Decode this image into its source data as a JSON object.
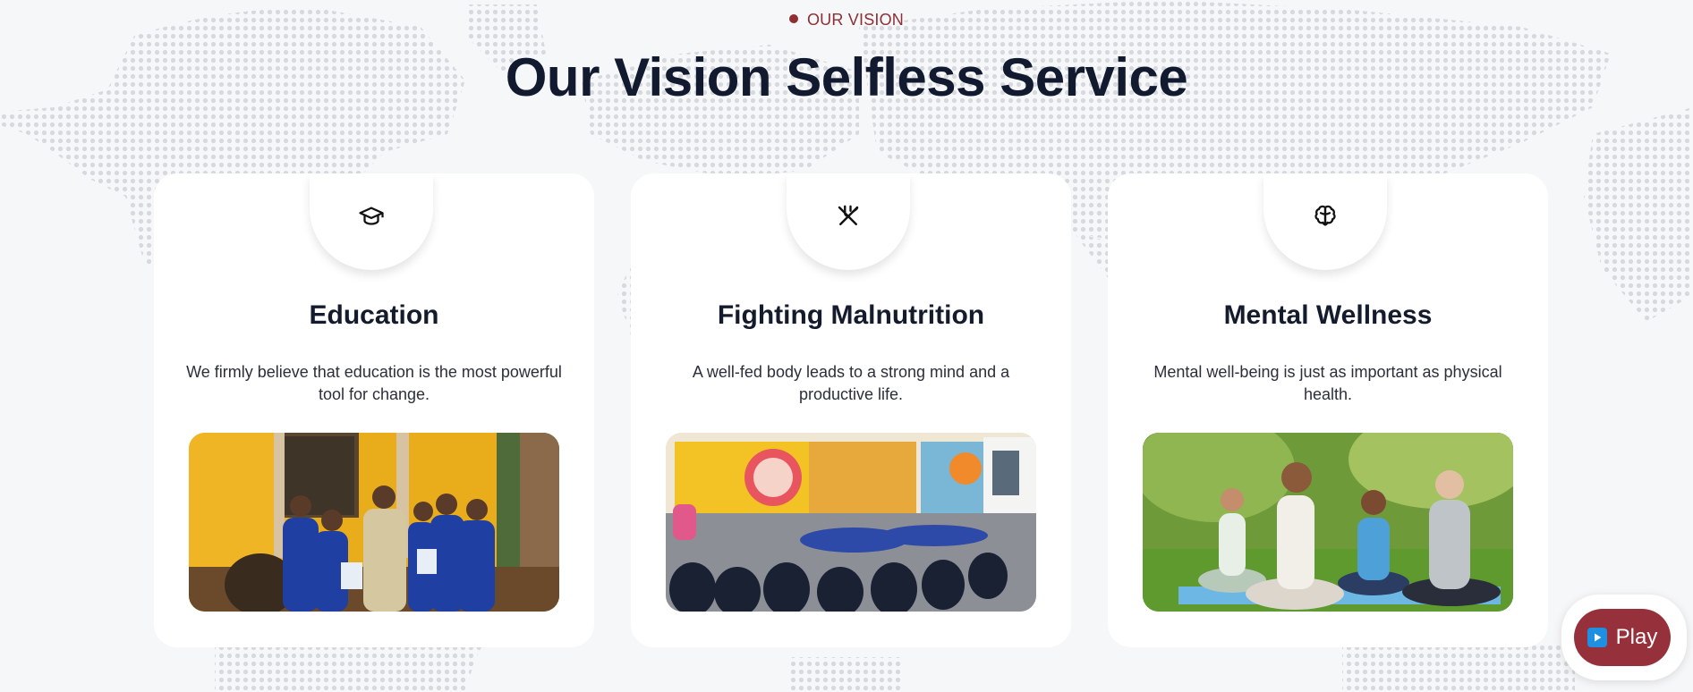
{
  "section": {
    "eyebrow": "OUR VISION",
    "title": "Our Vision Selfless Service"
  },
  "cards": [
    {
      "icon": "graduation-cap-icon",
      "title": "Education",
      "description": "We firmly believe that education is the most powerful tool for change."
    },
    {
      "icon": "fork-knife-icon",
      "title": "Fighting Malnutrition",
      "description": "A well-fed body leads to a strong mind and a productive life."
    },
    {
      "icon": "brain-icon",
      "title": "Mental Wellness",
      "description": "Mental well-being is just as important as physical health."
    }
  ],
  "play_button": {
    "label": "Play"
  },
  "colors": {
    "accent": "#96303a",
    "heading": "#111a2e",
    "background": "#f6f7f9",
    "card": "#ffffff"
  }
}
